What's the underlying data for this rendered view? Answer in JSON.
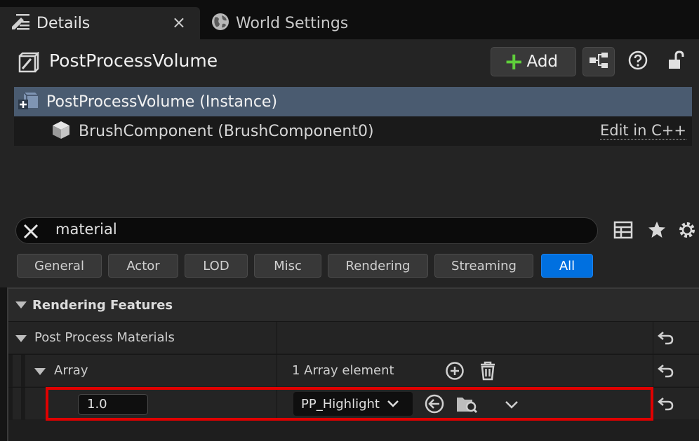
{
  "tabs": [
    {
      "label": "Details",
      "icon": "pencil-list-icon",
      "active": true
    },
    {
      "label": "World Settings",
      "icon": "globe-icon",
      "active": false
    }
  ],
  "tab_close": "×",
  "header": {
    "actor_name": "PostProcessVolume",
    "add_label": "Add"
  },
  "tree": {
    "instance_label": "PostProcessVolume (Instance)",
    "brush_label": "BrushComponent (BrushComponent0)",
    "edit_cpp": "Edit in C++"
  },
  "search": {
    "value": "material"
  },
  "filters": [
    {
      "label": "General",
      "active": false
    },
    {
      "label": "Actor",
      "active": false
    },
    {
      "label": "LOD",
      "active": false
    },
    {
      "label": "Misc",
      "active": false
    },
    {
      "label": "Rendering",
      "active": false
    },
    {
      "label": "Streaming",
      "active": false
    },
    {
      "label": "All",
      "active": true
    }
  ],
  "grid": {
    "category": "Rendering Features",
    "post_process_materials": "Post Process Materials",
    "array_label": "Array",
    "array_count": "1 Array element",
    "weight_value": "1.0",
    "material_value": "PP_Highlight"
  },
  "colors": {
    "accent": "#0070e0",
    "selection": "#4a5b70",
    "add_plus": "#5fcf3b",
    "highlight_box": "#e00000"
  }
}
